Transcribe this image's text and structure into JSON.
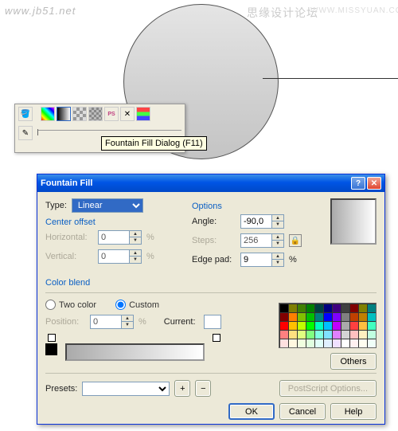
{
  "watermarks": {
    "left": "www.jb51.net",
    "center": "思缘设计论坛",
    "right": "WWW.MISSYUAN.COM"
  },
  "tooltip": "Fountain Fill Dialog (F11)",
  "dialog": {
    "title": "Fountain Fill",
    "type_label": "Type:",
    "type_value": "Linear",
    "options_title": "Options",
    "center_offset_title": "Center offset",
    "horizontal_label": "Horizontal:",
    "horizontal_value": "0",
    "vertical_label": "Vertical:",
    "vertical_value": "0",
    "angle_label": "Angle:",
    "angle_value": "-90,0",
    "steps_label": "Steps:",
    "steps_value": "256",
    "edge_label": "Edge pad:",
    "edge_value": "9",
    "edge_unit": "%",
    "colorblend_title": "Color blend",
    "twocolor": "Two color",
    "custom": "Custom",
    "position_label": "Position:",
    "position_value": "0",
    "position_unit": "%",
    "current_label": "Current:",
    "others_btn": "Others",
    "presets_label": "Presets:",
    "postscript_btn": "PostScript Options...",
    "ok": "OK",
    "cancel": "Cancel",
    "help": "Help"
  },
  "palette_colors": [
    "#000",
    "#7f7f00",
    "#408000",
    "#008000",
    "#004040",
    "#000080",
    "#400080",
    "#404040",
    "#800000",
    "#808000",
    "#008080",
    "#800000",
    "#ff8000",
    "#80c000",
    "#00c000",
    "#008080",
    "#0000ff",
    "#8000ff",
    "#808080",
    "#c04000",
    "#c08000",
    "#00c0c0",
    "#ff0000",
    "#ffc000",
    "#c0ff00",
    "#00ff00",
    "#00ffc0",
    "#00c0ff",
    "#c000ff",
    "#aaaaaa",
    "#ff4040",
    "#ffc040",
    "#40ffc0",
    "#ff8080",
    "#ffe080",
    "#e0ff80",
    "#80ff80",
    "#80ffe0",
    "#80e0ff",
    "#e080ff",
    "#d4d4d4",
    "#ffc0c0",
    "#fff0c0",
    "#c0ffe0",
    "#ffe0e0",
    "#fff8e0",
    "#f0ffe0",
    "#e0ffe0",
    "#e0fff8",
    "#e0f0ff",
    "#f0e0ff",
    "#ffffff",
    "#fff0f0",
    "#fffdf0",
    "#f0fff8"
  ]
}
